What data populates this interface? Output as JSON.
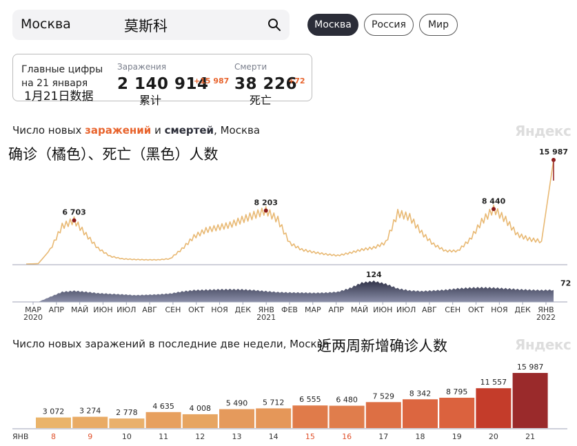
{
  "search": {
    "value": "Москва",
    "overlay_cn": "莫斯科"
  },
  "regions": [
    {
      "label": "Москва",
      "active": true
    },
    {
      "label": "Россия",
      "active": false
    },
    {
      "label": "Мир",
      "active": false
    }
  ],
  "summary": {
    "title_line1": "Главные цифры",
    "title_line2": "на 21 января",
    "title_cn": "1月21日数据",
    "infections": {
      "label": "Заражения",
      "value": "2 140 914",
      "delta": "+15 987",
      "cn": "累计"
    },
    "deaths": {
      "label": "Смерти",
      "value": "38 226",
      "delta": "+72",
      "cn": "死亡"
    }
  },
  "chart1_title": {
    "part1": "Число новых ",
    "part2": "заражений",
    "part3": " и ",
    "part4": "смертей",
    "part5": ", Москва"
  },
  "chart1_cn": "确诊（橘色）、死亡（黑色）人数",
  "chart2_title": "Число новых заражений в последние две недели, Москва",
  "chart2_cn": "近两周新增确诊人数",
  "watermark": "Яндекс",
  "colors": {
    "infections": "#e8b872",
    "deaths": "#4a4d68",
    "peak": "#8b1a1a",
    "accent": "#e8632c"
  },
  "chart_data": [
    {
      "type": "area",
      "title": "Число новых заражений и смертей, Москва",
      "x_labels": [
        "МАР",
        "АПР",
        "МАЙ",
        "ИЮН",
        "ИЮЛ",
        "АВГ",
        "СЕН",
        "ОКТ",
        "НОЯ",
        "ДЕК",
        "ЯНВ",
        "ФЕВ",
        "МАР",
        "АПР",
        "МАЙ",
        "ИЮН",
        "ИЮЛ",
        "АВГ",
        "СЕН",
        "ОКТ",
        "НОЯ",
        "ДЕК",
        "ЯНВ"
      ],
      "year_labels": [
        {
          "at": 0,
          "label": "2020"
        },
        {
          "at": 10,
          "label": "2021"
        },
        {
          "at": 22,
          "label": "2022"
        }
      ],
      "series": [
        {
          "name": "заражений",
          "values": [
            0,
            50,
            2200,
            5800,
            6703,
            4500,
            2400,
            1200,
            800,
            700,
            650,
            650,
            800,
            2300,
            4200,
            5200,
            5600,
            6000,
            6800,
            7500,
            8203,
            6800,
            3200,
            2200,
            1800,
            1500,
            1300,
            1700,
            2200,
            2500,
            3300,
            7800,
            7200,
            4800,
            3000,
            2000,
            2000,
            3700,
            6500,
            8440,
            6800,
            4500,
            3800,
            3500,
            15987
          ],
          "labels": [
            {
              "index": 4,
              "text": "6 703"
            },
            {
              "index": 20,
              "text": "8 203"
            },
            {
              "index": 39,
              "text": "8 440"
            },
            {
              "index": 44,
              "text": "15 987"
            }
          ]
        },
        {
          "name": "смертей",
          "values": [
            0,
            0,
            30,
            60,
            66,
            60,
            52,
            48,
            45,
            40,
            42,
            45,
            50,
            62,
            70,
            72,
            74,
            75,
            74,
            70,
            64,
            58,
            56,
            55,
            54,
            55,
            60,
            82,
            115,
            124,
            108,
            80,
            68,
            64,
            68,
            72,
            80,
            84,
            86,
            84,
            80,
            75,
            72,
            70,
            72
          ],
          "labels": [
            {
              "index": 29,
              "text": "124"
            },
            {
              "index": 44,
              "text": "72"
            }
          ]
        }
      ]
    },
    {
      "type": "bar",
      "title": "Число новых заражений в последние две недели, Москва",
      "month_label": "ЯНВ",
      "categories": [
        "8",
        "9",
        "10",
        "11",
        "12",
        "13",
        "14",
        "15",
        "16",
        "17",
        "18",
        "19",
        "20",
        "21"
      ],
      "values": [
        3072,
        3274,
        2778,
        4635,
        4008,
        5490,
        5712,
        6555,
        6480,
        7529,
        8342,
        8795,
        11557,
        15987
      ],
      "value_labels": [
        "3 072",
        "3 274",
        "2 778",
        "4 635",
        "4 008",
        "5 490",
        "5 712",
        "6 555",
        "6 480",
        "7 529",
        "8 342",
        "8 795",
        "11 557",
        "15 987"
      ],
      "weekend_categories": [
        "8",
        "9",
        "15",
        "16"
      ],
      "colors": [
        "#eab46a",
        "#e9ab65",
        "#e9b06c",
        "#e7a05f",
        "#e7a561",
        "#e59a5c",
        "#e59759",
        "#e07b4a",
        "#e07d4c",
        "#dd6f44",
        "#dc6640",
        "#db623e",
        "#c43c2a",
        "#9a2a2b"
      ]
    }
  ]
}
